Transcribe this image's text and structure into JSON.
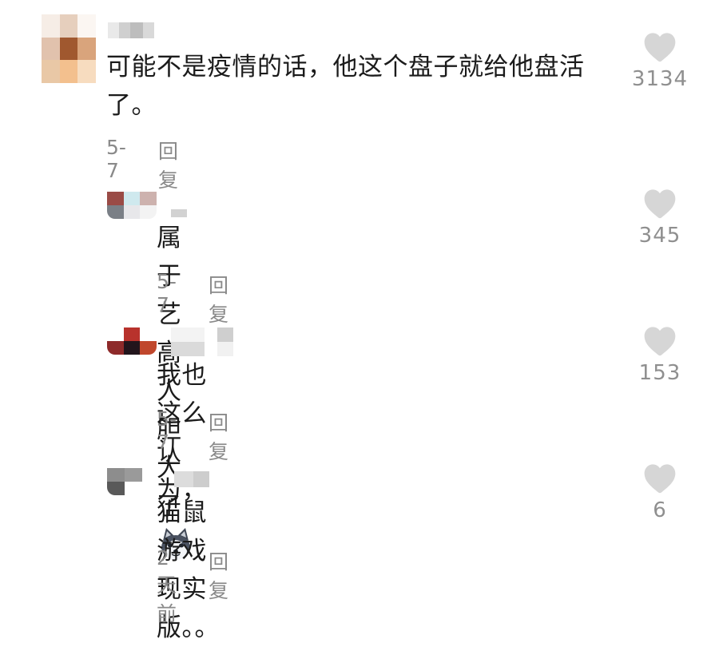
{
  "comments": [
    {
      "text": "可能不是疫情的话，他这个盘子就给他盘活了。",
      "date": "5-7",
      "reply_label": "回复",
      "likes": "3134"
    },
    {
      "text": "属于艺高人胆大了",
      "emoji": "husky-dog-emoji",
      "date": "5-7",
      "reply_label": "回复",
      "likes": "345"
    },
    {
      "text": "我也这么认为，",
      "date": "5-7",
      "reply_label": "回复",
      "likes": "153"
    },
    {
      "text": "猫鼠游戏现实版。。",
      "date": "2天前",
      "reply_label": "回复",
      "likes": "6"
    }
  ],
  "colors": {
    "heart": "#d6d6d6",
    "meta": "#8a8a8a",
    "text": "#1b1b1b"
  }
}
